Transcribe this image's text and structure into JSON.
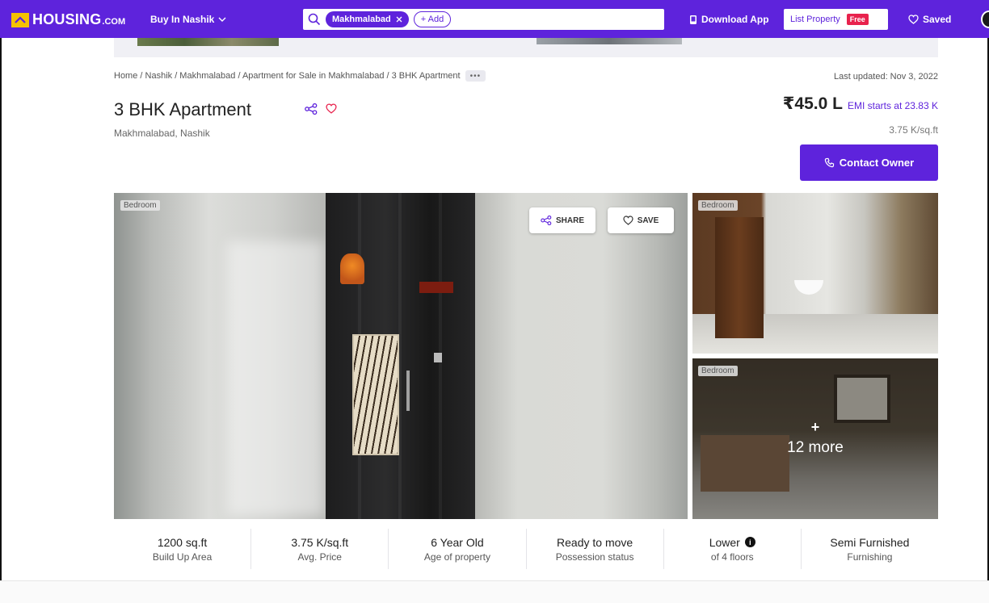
{
  "header": {
    "logo_word": "HOUSING",
    "logo_com": ".COM",
    "city_select": "Buy In Nashik",
    "search_chip": "Makhmalabad",
    "search_add": "+ Add",
    "download_app": "Download App",
    "list_property": "List Property",
    "free_badge": "Free",
    "saved": "Saved"
  },
  "breadcrumb": {
    "text": "Home / Nashik / Makhmalabad / Apartment for Sale in Makhmalabad / 3 BHK Apartment",
    "more": "•••"
  },
  "listing": {
    "last_updated": "Last updated: Nov 3, 2022",
    "title": "3 BHK Apartment",
    "locality": "Makhmalabad, Nashik",
    "price": "₹45.0 L",
    "emi": "EMI starts at 23.83 K",
    "rate": "3.75 K/sq.ft",
    "contact_button": "Contact Owner"
  },
  "gallery": {
    "main_tag": "Bedroom",
    "share_button": "SHARE",
    "save_button": "SAVE",
    "side1_tag": "Bedroom",
    "side2_tag": "Bedroom",
    "more_plus": "+",
    "more_label": "12 more"
  },
  "facts": [
    {
      "value": "1200 sq.ft",
      "label": "Build Up Area"
    },
    {
      "value": "3.75 K/sq.ft",
      "label": "Avg. Price"
    },
    {
      "value": "6 Year Old",
      "label": "Age of property"
    },
    {
      "value": "Ready to move",
      "label": "Possession status"
    },
    {
      "value": "Lower",
      "label": "of 4 floors"
    },
    {
      "value": "Semi Furnished",
      "label": "Furnishing"
    }
  ],
  "icons": {
    "info": "i"
  },
  "colors": {
    "brand": "#5e23dc",
    "logo_accent": "#f5c200",
    "free_badge": "#e8224d"
  }
}
